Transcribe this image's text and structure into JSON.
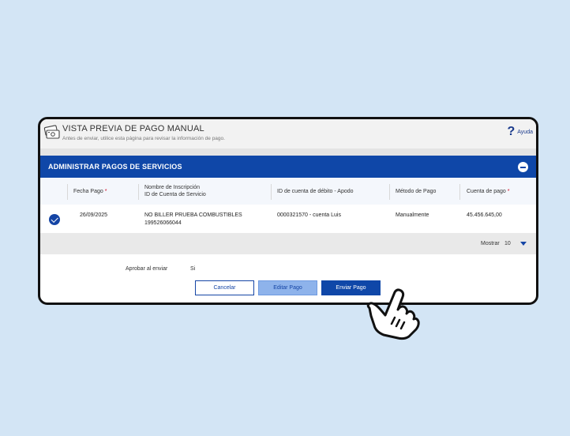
{
  "header": {
    "title": "VISTA PREVIA DE PAGO MANUAL",
    "subtitle": "Antes de enviar, utilice esta página para revisar la información de pago.",
    "help_label": "Ayuda",
    "help_icon": "question-mark-icon",
    "logo_icon": "payment-cards-icon"
  },
  "section": {
    "title": "ADMINISTRAR PAGOS DE SERVICIOS",
    "collapse_icon": "minus-circle-icon"
  },
  "table": {
    "columns": {
      "fecha": "Fecha Pago",
      "nombre_1": "Nombre de Inscripción",
      "nombre_2": "ID de Cuenta de Servicio",
      "cuenta_debito": "ID de cuenta de débito - Apodo",
      "metodo": "Método de Pago",
      "cuenta_pago": "Cuenta de pago",
      "required_marker": "*"
    },
    "rows": [
      {
        "fecha": "26/09/2025",
        "nombre": "NO BILLER PRUEBA COMBUSTIBLES",
        "id_servicio": "199526066044",
        "cuenta_debito": "0000321570 - cuenta Luis",
        "metodo": "Manualmente",
        "cuenta_pago": "45.456.645,00",
        "selected": true
      }
    ]
  },
  "pager": {
    "label": "Mostrar",
    "value": "10"
  },
  "approve": {
    "label": "Aprobar al enviar",
    "value": "Si"
  },
  "buttons": {
    "cancel": "Cancelar",
    "edit": "Editar Pago",
    "send": "Enviar Pago"
  },
  "colors": {
    "primary": "#0f47a8",
    "background": "#d3e5f5",
    "required": "#d0021b"
  }
}
